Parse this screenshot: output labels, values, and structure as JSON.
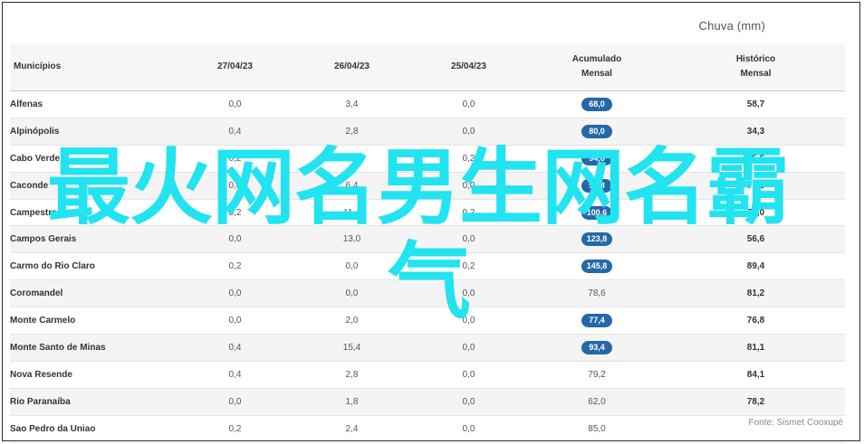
{
  "chart_label": "Chuva (mm)",
  "source": "Fonte: Sismet Cooxupé",
  "overlay": {
    "line1": "最火网名男生网名霸",
    "line2": "气"
  },
  "colors": {
    "pill": "#2468a8",
    "overlay": "#22e3f0"
  },
  "headers": {
    "municipios": "Municípios",
    "d1": "27/04/23",
    "d2": "26/04/23",
    "d3": "25/04/23",
    "acum1": "Acumulado",
    "acum2": "Mensal",
    "hist1": "Histórico",
    "hist2": "Mensal"
  },
  "rows": [
    {
      "name": "Alfenas",
      "d1": "0,0",
      "d2": "3,4",
      "d3": "0,0",
      "acum": "68,0",
      "pill": true,
      "hist": "58,7"
    },
    {
      "name": "Alpinópolis",
      "d1": "0,4",
      "d2": "2,8",
      "d3": "0,0",
      "acum": "80,0",
      "pill": true,
      "hist": "34,3"
    },
    {
      "name": "Cabo Verde",
      "d1": "0,2",
      "d2": "11,4",
      "d3": "0,2",
      "acum": "94,6",
      "pill": true,
      "hist": "75,6"
    },
    {
      "name": "Caconde",
      "d1": "0,0",
      "d2": "6,4",
      "d3": "0,0",
      "acum": "90,8",
      "pill": true,
      "hist": "77,6"
    },
    {
      "name": "Campestre",
      "d1": "0,2",
      "d2": "11,4",
      "d3": "0,2",
      "acum": "100,6",
      "pill": true,
      "hist": "79,0"
    },
    {
      "name": "Campos Gerais",
      "d1": "0,0",
      "d2": "13,0",
      "d3": "0,0",
      "acum": "123,8",
      "pill": true,
      "hist": "56,6"
    },
    {
      "name": "Carmo do Rio Claro",
      "d1": "0,2",
      "d2": "0,0",
      "d3": "0,2",
      "acum": "145,8",
      "pill": true,
      "hist": "89,4"
    },
    {
      "name": "Coromandel",
      "d1": "0,0",
      "d2": "0,0",
      "d3": "0,0",
      "acum": "78,6",
      "pill": false,
      "hist": "81,2"
    },
    {
      "name": "Monte Carmelo",
      "d1": "0,0",
      "d2": "2,0",
      "d3": "0,0",
      "acum": "77,4",
      "pill": true,
      "hist": "76,8"
    },
    {
      "name": "Monte Santo de Minas",
      "d1": "0,4",
      "d2": "15,4",
      "d3": "0,0",
      "acum": "93,4",
      "pill": true,
      "hist": "81,1"
    },
    {
      "name": "Nova Resende",
      "d1": "0,4",
      "d2": "2,8",
      "d3": "0,0",
      "acum": "79,2",
      "pill": false,
      "hist": "84,1"
    },
    {
      "name": "Rio Paranaíba",
      "d1": "0,0",
      "d2": "1,8",
      "d3": "0,0",
      "acum": "62,0",
      "pill": false,
      "hist": "78,2"
    },
    {
      "name": "Sao Pedro da Uniao",
      "d1": "0,2",
      "d2": "2,4",
      "d3": "0,0",
      "acum": "85,0",
      "pill": false,
      "hist": ""
    }
  ]
}
